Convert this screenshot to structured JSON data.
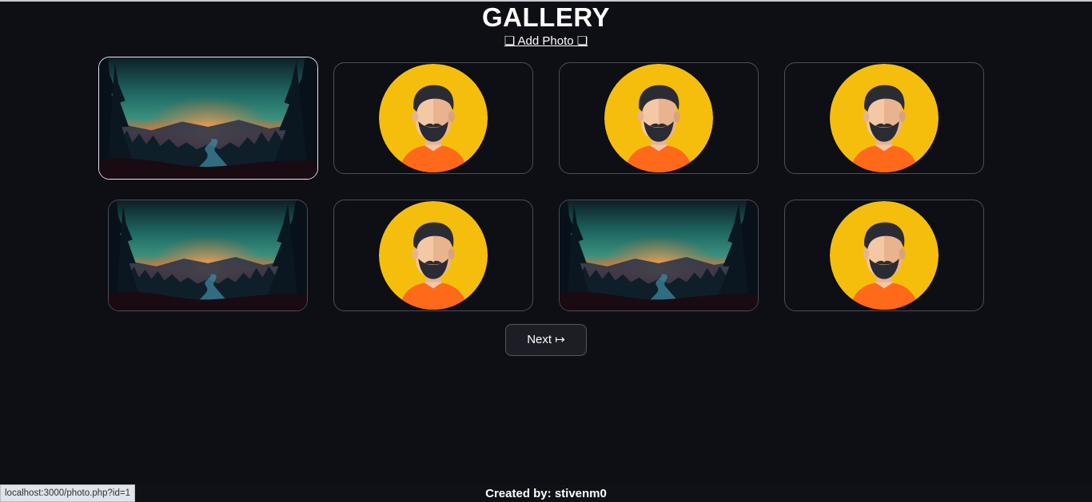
{
  "page": {
    "title": "GALLERY",
    "add_photo_label": "❏ Add Photo ❏",
    "next_label": "Next ↦",
    "footer_text": "Created by: stivenm0",
    "status_url": "localhost:3000/photo.php?id=1"
  },
  "gallery": {
    "items": [
      {
        "kind": "landscape",
        "selected": true
      },
      {
        "kind": "avatar",
        "selected": false
      },
      {
        "kind": "avatar",
        "selected": false
      },
      {
        "kind": "avatar",
        "selected": false
      },
      {
        "kind": "landscape",
        "selected": false
      },
      {
        "kind": "avatar",
        "selected": false
      },
      {
        "kind": "landscape",
        "selected": false
      },
      {
        "kind": "avatar",
        "selected": false
      }
    ]
  },
  "colors": {
    "background": "#0e0e15",
    "avatar_circle": "#f5be0c",
    "avatar_shirt": "#ff6a1a",
    "avatar_skin": "#f3c8a5",
    "avatar_hair": "#2b2b33",
    "card_border": "#4d4d57",
    "selected_border": "#e8e8ee"
  }
}
